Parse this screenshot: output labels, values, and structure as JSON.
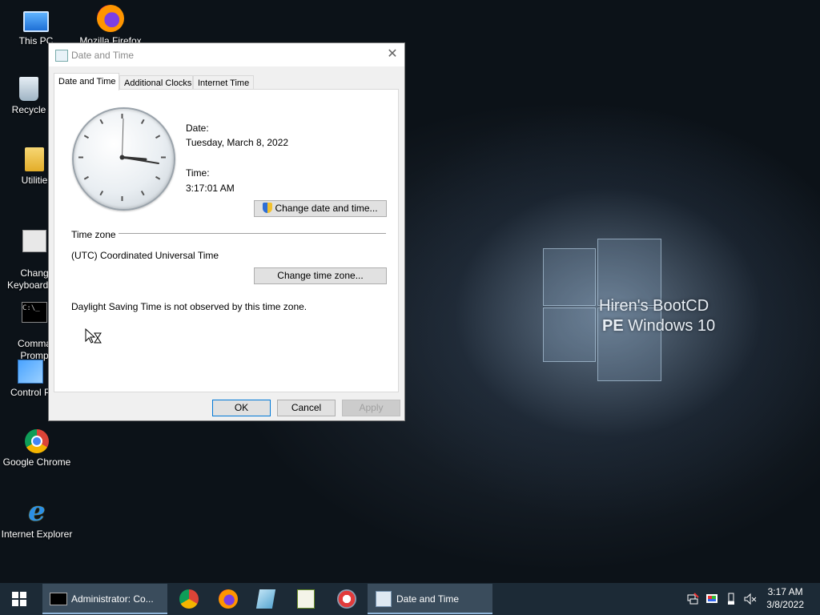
{
  "desktop": {
    "icons": [
      {
        "label": "This PC"
      },
      {
        "label": "Mozilla Firefox"
      },
      {
        "label": "Recycle"
      },
      {
        "label": "Utilitie"
      },
      {
        "label": "Chang\nKeyboard La"
      },
      {
        "label": "Comma\nPromp"
      },
      {
        "label": "Control P"
      },
      {
        "label": "Google Chrome"
      },
      {
        "label": "Internet Explorer"
      }
    ],
    "wallpaper": {
      "line1": "Hiren's BootCD",
      "line2_bold": "PE",
      "line2_rest": " Windows 10"
    }
  },
  "dialog": {
    "title": "Date and Time",
    "close_glyph": "✕",
    "tabs": [
      {
        "label": "Date and Time",
        "active": true
      },
      {
        "label": "Additional Clocks",
        "active": false
      },
      {
        "label": "Internet Time",
        "active": false
      }
    ],
    "date_label": "Date:",
    "date_value": "Tuesday, March 8, 2022",
    "time_label": "Time:",
    "time_value": "3:17:01 AM",
    "change_datetime_button": "Change date and time...",
    "timezone_heading": "Time zone",
    "timezone_value": "(UTC) Coordinated Universal Time",
    "change_timezone_button": "Change time zone...",
    "dst_note": "Daylight Saving Time is not observed by this time zone.",
    "ok_button": "OK",
    "cancel_button": "Cancel",
    "apply_button": "Apply"
  },
  "taskbar": {
    "cmd_window_label": "Administrator: Co...",
    "datetime_window_label": "Date and Time",
    "clock_time": "3:17 AM",
    "clock_date": "3/8/2022",
    "prompt_glyph": "C:\\_"
  },
  "colors": {
    "taskbar_bg": "#1c2a36",
    "button_focus": "#0078d7",
    "desktop_bg": "#0b1117"
  }
}
